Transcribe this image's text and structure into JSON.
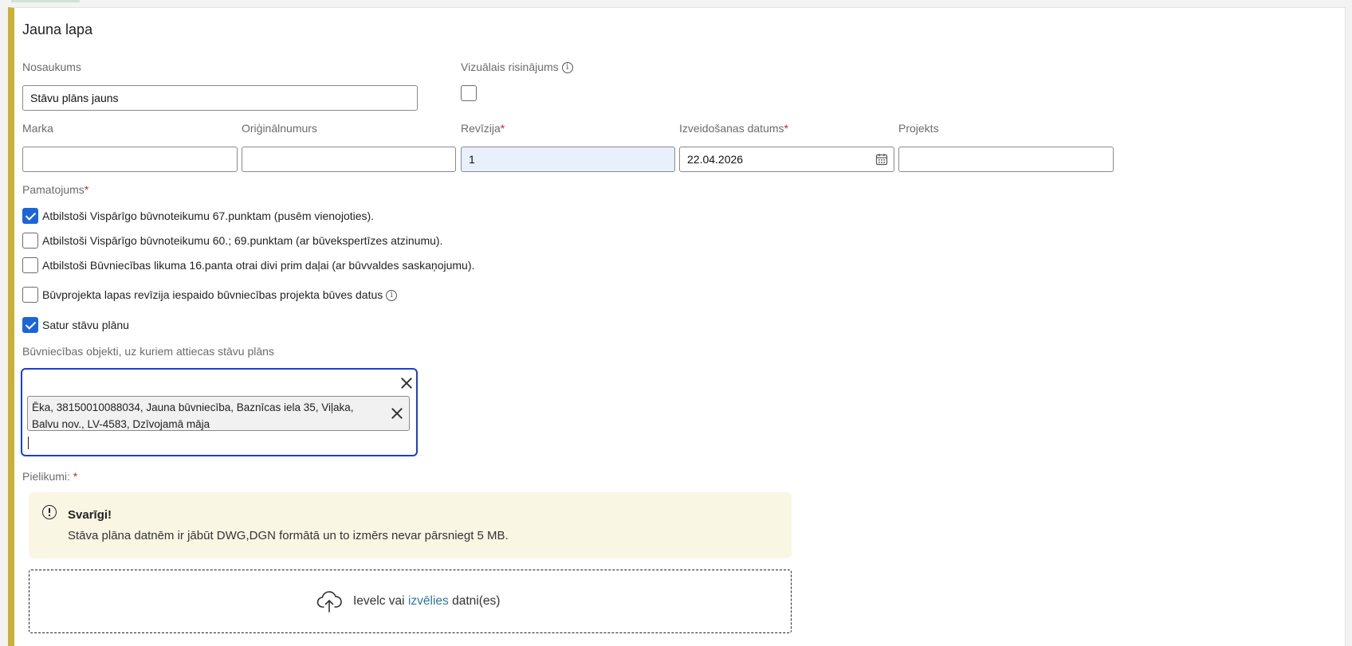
{
  "page": {
    "title": "Jauna lapa"
  },
  "form": {
    "name": {
      "label": "Nosaukums",
      "value": "Stāvu plāns jauns"
    },
    "visual": {
      "label": "Vizuālais risinājums",
      "checked": false
    },
    "marka": {
      "label": "Marka",
      "value": ""
    },
    "original_number": {
      "label": "Oriģinālnumurs",
      "value": ""
    },
    "revision": {
      "label": "Revīzija",
      "required_mark": "*",
      "value": "1"
    },
    "created_date": {
      "label": "Izveidošanas datums",
      "required_mark": "*",
      "value": "22.04.2026"
    },
    "project": {
      "label": "Projekts",
      "value": ""
    },
    "basis": {
      "label": "Pamatojums",
      "required_mark": "*",
      "options": [
        {
          "label": "Atbilstoši Vispārīgo būvnoteikumu 67.punktam (pusēm vienojoties).",
          "checked": true
        },
        {
          "label": "Atbilstoši Vispārīgo būvnoteikumu 60.; 69.punktam (ar būvekspertīzes atzinumu).",
          "checked": false
        },
        {
          "label": "Atbilstoši Būvniecības likuma 16.panta otrai divi prim daļai (ar būvvaldes saskaņojumu).",
          "checked": false
        }
      ]
    },
    "revision_affects": {
      "label": "Būvprojekta lapas revīzija iespaido būvniecības projekta būves datus",
      "checked": false
    },
    "contains_floor_plan": {
      "label": "Satur stāvu plānu",
      "checked": true
    },
    "objects": {
      "label": "Būvniecības objekti, uz kuriem attiecas stāvu plāns",
      "chips": [
        {
          "line1": "Ēka, 38150010088034, Jauna būvniecība, Baznīcas iela 35, Viļaka,",
          "line2": "Balvu nov., LV-4583, Dzīvojamā māja"
        }
      ]
    },
    "attachments": {
      "label": "Pielikumi:",
      "required_mark": "*",
      "notice_title": "Svarīgi!",
      "notice_text": "Stāva plāna datnēm ir jābūt DWG,DGN formātā un to izmērs nevar pārsniegt 5 MB.",
      "drop_prefix": "Ievelc vai",
      "drop_link": "izvēlies",
      "drop_suffix": "datni(es)"
    }
  },
  "colors": {
    "accent_bar": "#c9b037",
    "focus_border": "#1a3fd1",
    "checkbox_checked": "#1a66d8",
    "required": "#d32020",
    "notice_bg": "#faf6e4",
    "link": "#2c7a9b",
    "readonly_bg": "#e8f0fc"
  },
  "icons": [
    "info-icon",
    "calendar-icon",
    "close-icon",
    "chip-remove-icon",
    "warning-circle-icon",
    "cloud-upload-icon"
  ]
}
